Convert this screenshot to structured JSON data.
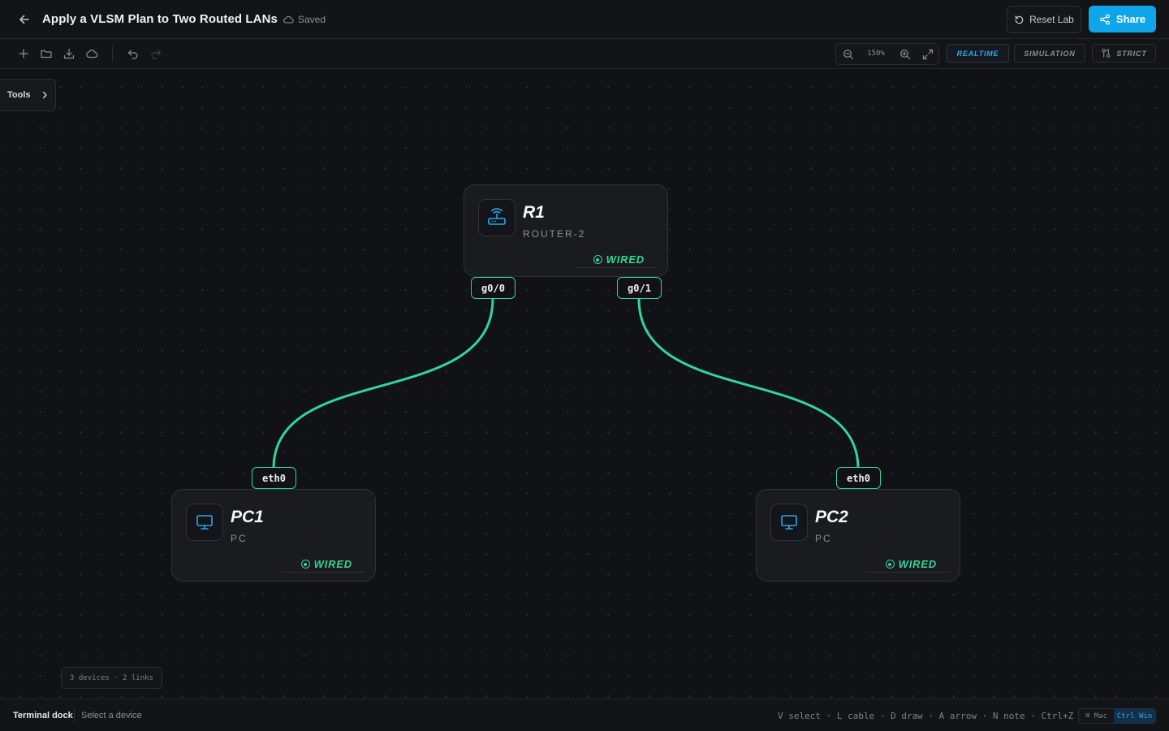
{
  "header": {
    "title": "Apply a VLSM Plan to Two Routed LANs",
    "saved_status": "Saved",
    "reset_label": "Reset Lab",
    "share_label": "Share"
  },
  "toolbar": {
    "zoom_level": "150%",
    "modes": [
      {
        "label": "REALTIME",
        "active": true
      },
      {
        "label": "SIMULATION",
        "active": false
      },
      {
        "label": "STRICT",
        "active": false
      }
    ]
  },
  "sidebar": {
    "tools_label": "Tools"
  },
  "devices": [
    {
      "name": "R1",
      "type": "ROUTER-2",
      "status": "WIRED",
      "icon": "router-icon"
    },
    {
      "name": "PC1",
      "type": "PC",
      "status": "WIRED",
      "icon": "monitor-icon"
    },
    {
      "name": "PC2",
      "type": "PC",
      "status": "WIRED",
      "icon": "monitor-icon"
    }
  ],
  "ports": {
    "r1_left": "g0/0",
    "r1_right": "g0/1",
    "pc1": "eth0",
    "pc2": "eth0"
  },
  "canvas_stats": "3 devices · 2 links",
  "footer": {
    "dock_title": "Terminal dock",
    "dock_hint": "Select a device",
    "shortcuts": "V select · L cable · D draw · A arrow · N note · Ctrl+Z undo",
    "os_options": [
      "⌘ Mac",
      "Ctrl Win"
    ],
    "os_active": "Ctrl Win"
  },
  "colors": {
    "accent": "#0ea5e9",
    "link": "#34d399",
    "background": "#111215"
  }
}
